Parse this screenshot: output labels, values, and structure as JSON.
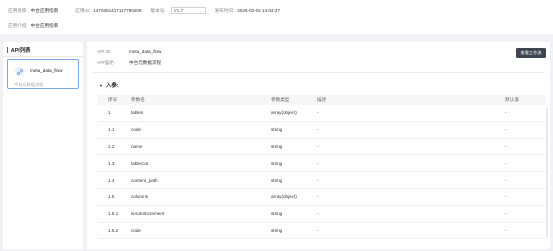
{
  "app": {
    "name_label": "应用名称:",
    "name_value": "中台应用指南",
    "id_label": "应用ID:",
    "id_value": "1470361417117790208",
    "version_label": "版本号:",
    "version_value": "V1.7",
    "publish_label": "发布时间:",
    "publish_value": "2026-03-02 14:04:27",
    "intro_label": "应用介绍:",
    "intro_value": "中台应用指南"
  },
  "sidebar": {
    "title": "API列表",
    "items": [
      {
        "name": "meta_data_flow",
        "desc": "中台元数据流程"
      }
    ]
  },
  "detail": {
    "api_id_label": "API ID:",
    "api_id_value": "meta_data_flow",
    "api_desc_label": "API描述:",
    "api_desc_value": "中台元数据流程",
    "action_button": "查看工作流",
    "section_title": "入参:"
  },
  "table": {
    "headers": [
      "序号",
      "参数名",
      "参数类型",
      "描述",
      "默认值"
    ],
    "rows": [
      [
        "1",
        "tables",
        "array(object)",
        "-",
        "-"
      ],
      [
        "1.1",
        "code",
        "string",
        "-",
        "-"
      ],
      [
        "1.2",
        "name",
        "string",
        "-",
        "-"
      ],
      [
        "1.3",
        "tableCat",
        "string",
        "-",
        "-"
      ],
      [
        "1.4",
        "content_path",
        "string",
        "-",
        "-"
      ],
      [
        "1.5",
        "columns",
        "array(object)",
        "-",
        "-"
      ],
      [
        "1.5.1",
        "isAutoIncrement",
        "string",
        "-",
        "-"
      ],
      [
        "1.5.2",
        "code",
        "string",
        "-",
        "-"
      ]
    ]
  },
  "icons": {
    "chevron": "chevron-down-icon",
    "api_item": "api-link-icon",
    "section_caret": "caret-down-icon"
  },
  "colors": {
    "accent": "#2f6ce5",
    "button_dark": "#3d4452"
  }
}
